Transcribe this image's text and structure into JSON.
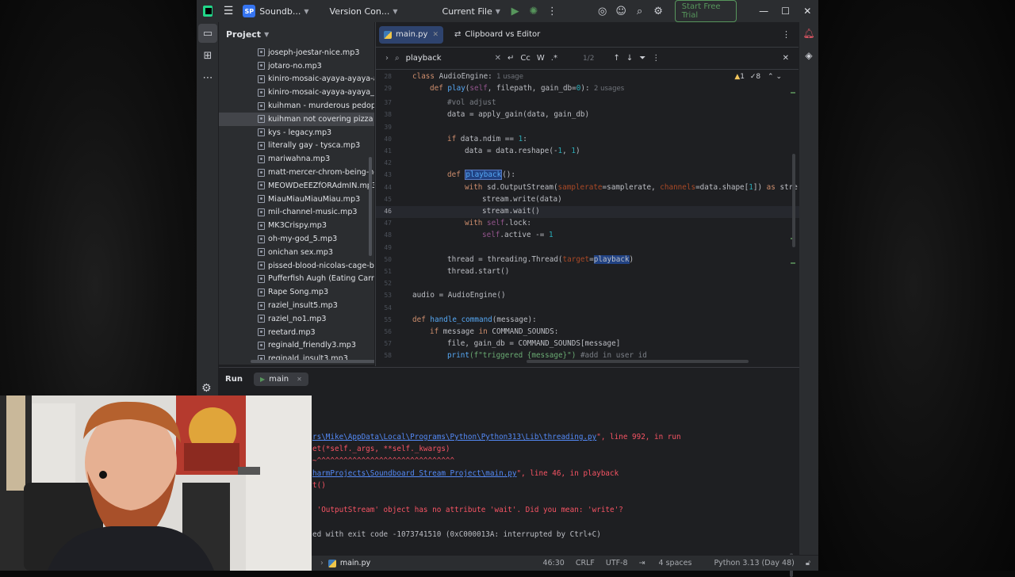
{
  "titlebar": {
    "project_badge": "SP",
    "project_name": "Soundb...",
    "vcs": "Version Con...",
    "run_config": "Current File",
    "trial_button": "Start Free Trial"
  },
  "project_panel": {
    "title": "Project",
    "files": [
      "joseph-joestar-nice.mp3",
      "jotaro-no.mp3",
      "kiniro-mosaic-ayaya-ayaya-ay",
      "kiniro-mosaic-ayaya-ayaya_Hc",
      "kuihman - murderous pedoph",
      "kuihman not covering pizza cl",
      "kys - legacy.mp3",
      "literally gay - tysca.mp3",
      "mariwahna.mp3",
      "matt-mercer-chrom-being-he",
      "MEOWDeEEZfORAdmIN.mp3",
      "MiauMiauMiauMiau.mp3",
      "mil-channel-music.mp3",
      "MK3Crispy.mp3",
      "oh-my-god_5.mp3",
      "onichan sex.mp3",
      "pissed-blood-nicolas-cage-be",
      "Pufferfish Augh (Eating Carrot",
      "Rape Song.mp3",
      "raziel_insult5.mp3",
      "raziel_no1.mp3",
      "reetard.mp3",
      "reginald_friendly3.mp3",
      "reginald_insult3.mp3"
    ],
    "selected_index": 5
  },
  "editor": {
    "tabs": [
      {
        "label": "main.py",
        "active": true
      },
      {
        "label": "Clipboard vs Editor",
        "active": false
      }
    ],
    "find": {
      "query": "playback",
      "count": "1/2",
      "match_case": "Cc",
      "words": "W",
      "regex": ".*"
    },
    "inspections": {
      "warnings": "1",
      "weak": "8"
    },
    "line_numbers": [
      "28",
      "29",
      "37",
      "38",
      "39",
      "40",
      "41",
      "42",
      "43",
      "44",
      "45",
      "46",
      "47",
      "48",
      "49",
      "50",
      "51",
      "52",
      "53",
      "54",
      "55",
      "56",
      "57",
      "58"
    ],
    "code": {
      "l28_kw": "class",
      "l28_name": " AudioEngine:",
      "l28_hint": "  1 usage",
      "l29_kw": "def",
      "l29_fn": "play",
      "l29_self": "self",
      "l29_rest": ", filepath, gain_db=",
      "l29_num": "0",
      "l29_end": "):",
      "l29_hint": "  2 usages",
      "l37": "#vol adjust",
      "l38": "data = apply_gain(data, gain_db)",
      "l40_kw": "if",
      "l40_rest": " data.ndim == ",
      "l40_num": "1",
      "l40_end": ":",
      "l41_a": "data = data.reshape(-",
      "l41_n1": "1",
      "l41_b": ", ",
      "l41_n2": "1",
      "l41_c": ")",
      "l43_kw": "def",
      "l43_fn": "playback",
      "l43_end": "():",
      "l44_kw": "with",
      "l44_a": " sd.OutputStream(",
      "l44_p1": "samplerate",
      "l44_b": "=samplerate, ",
      "l44_p2": "channels",
      "l44_c": "=data.shape[",
      "l44_n": "1",
      "l44_d": "]) ",
      "l44_kw2": "as",
      "l44_e": " stre",
      "l45": "stream.write(data)",
      "l46": "stream.wait()",
      "l47_kw": "with",
      "l47_self": " self",
      "l47_rest": ".lock:",
      "l48_self": "self",
      "l48_rest": ".active -= ",
      "l48_num": "1",
      "l50_a": "thread = threading.Thread(",
      "l50_p": "target",
      "l50_eq": "=",
      "l50_hl": "playback",
      "l50_end": ")",
      "l51": "thread.start()",
      "l53": "audio = AudioEngine()",
      "l55_kw": "def",
      "l55_fn": "handle_command",
      "l55_rest": "(message):",
      "l56_kw": "if",
      "l56_rest": " message ",
      "l56_kw2": "in",
      "l56_end": " COMMAND_SOUNDS:",
      "l57": "file, gain_db = COMMAND_SOUNDS[message]",
      "l58_fn": "print",
      "l58_str": "(f\"triggered {message}\")",
      "l58_cmt": " #add in user id"
    }
  },
  "run_panel": {
    "title": "Run",
    "tab": "main",
    "output": {
      "o1_link": "rs\\Mike\\AppData\\Local\\Programs\\Python\\Python313\\Lib\\threading.py",
      "o1_rest": "\", line 992, in run",
      "o2": "et(*self._args, **self._kwargs)",
      "o3": "~^^^^^^^^^^^^^^^^^^^^^^^^^^^^^^^",
      "o4_link": "harmProjects\\Soundboard Stream Project\\main.py",
      "o4_rest": "\", line 46, in playback",
      "o5": "t()",
      "o6": " 'OutputStream' object has no attribute 'wait'. Did you mean: 'write'?",
      "o7": "ed with exit code -1073741510 (0xC000013A: interrupted by Ctrl+C)"
    }
  },
  "statusbar": {
    "file": "main.py",
    "position": "46:30",
    "line_sep": "CRLF",
    "encoding": "UTF-8",
    "indent": "4 spaces",
    "interpreter": "Python 3.13 (Day 48)"
  }
}
